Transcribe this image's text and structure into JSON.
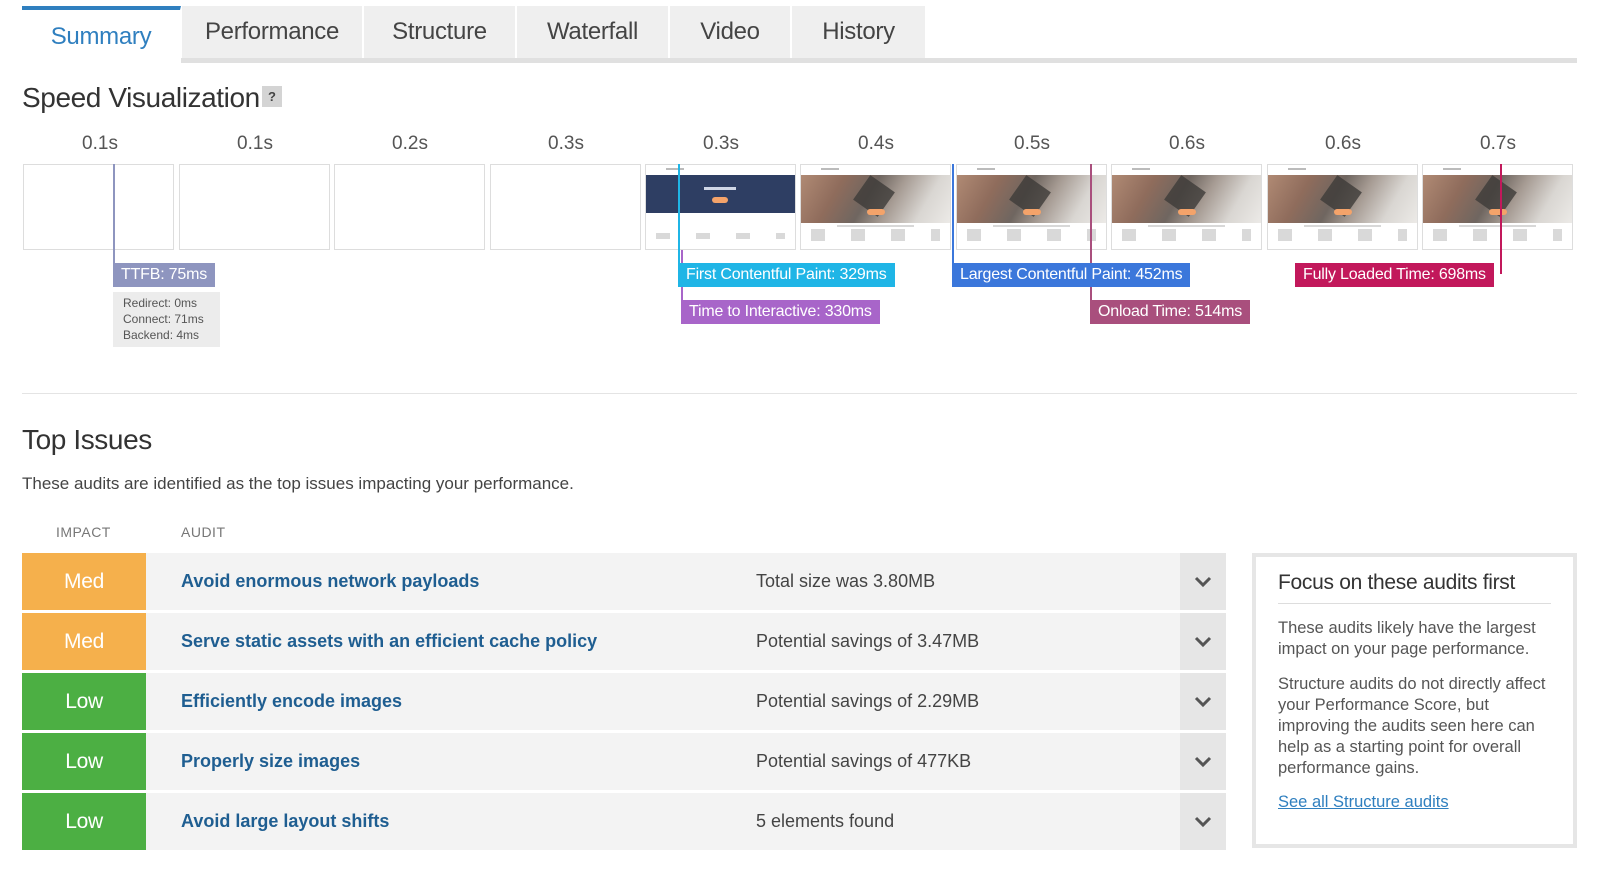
{
  "tabs": [
    {
      "label": "Summary",
      "active": true
    },
    {
      "label": "Performance"
    },
    {
      "label": "Structure"
    },
    {
      "label": "Waterfall"
    },
    {
      "label": "Video"
    },
    {
      "label": "History"
    }
  ],
  "speed": {
    "title": "Speed Visualization",
    "help": "?",
    "timeline": [
      "0.1s",
      "0.1s",
      "0.2s",
      "0.3s",
      "0.3s",
      "0.4s",
      "0.5s",
      "0.6s",
      "0.6s",
      "0.7s"
    ],
    "markers": {
      "ttfb": "TTFB: 75ms",
      "fcp": "First Contentful Paint: 329ms",
      "tti": "Time to Interactive: 330ms",
      "lcp": "Largest Contentful Paint: 452ms",
      "onload": "Onload Time: 514ms",
      "fully_loaded": "Fully Loaded Time: 698ms"
    },
    "ttfb_detail": {
      "redirect": "Redirect: 0ms",
      "connect": "Connect: 71ms",
      "backend": "Backend: 4ms"
    }
  },
  "issues": {
    "title": "Top Issues",
    "description": "These audits are identified as the top issues impacting your performance.",
    "col_impact": "IMPACT",
    "col_audit": "AUDIT",
    "rows": [
      {
        "impact": "Med",
        "title": "Avoid enormous network payloads",
        "value": "Total size was 3.80MB"
      },
      {
        "impact": "Med",
        "title": "Serve static assets with an efficient cache policy",
        "value": "Potential savings of 3.47MB"
      },
      {
        "impact": "Low",
        "title": "Efficiently encode images",
        "value": "Potential savings of 2.29MB"
      },
      {
        "impact": "Low",
        "title": "Properly size images",
        "value": "Potential savings of 477KB"
      },
      {
        "impact": "Low",
        "title": "Avoid large layout shifts",
        "value": "5 elements found"
      }
    ]
  },
  "focus": {
    "title": "Focus on these audits first",
    "p1": "These audits likely have the largest impact on your page performance.",
    "p2": "Structure audits do not directly affect your Performance Score, but improving the audits seen here can help as a starting point for overall performance gains.",
    "link": "See all Structure audits"
  },
  "colors": {
    "accent": "#2f7fbf",
    "med": "#f5b04c",
    "low": "#4caf43",
    "ttfb": "#8e95bf",
    "fcp": "#1fb5e6",
    "tti": "#a865c9",
    "lcp": "#3b77db",
    "onload": "#a94f7d",
    "fully_loaded": "#c2185b"
  }
}
